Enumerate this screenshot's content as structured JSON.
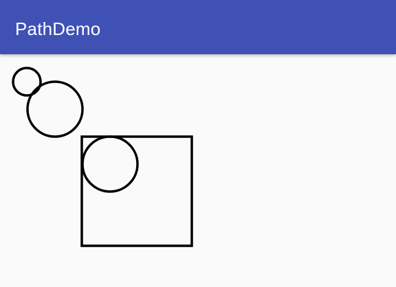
{
  "app_bar": {
    "title": "PathDemo",
    "color": "#3f51b5",
    "title_color": "#ffffff"
  },
  "canvas": {
    "background": "#fafafa",
    "stroke_color": "#000000",
    "shapes": [
      {
        "type": "circle",
        "name": "small-circle"
      },
      {
        "type": "circle",
        "name": "medium-circle"
      },
      {
        "type": "rect",
        "name": "square"
      },
      {
        "type": "circle",
        "name": "inner-circle"
      }
    ]
  }
}
